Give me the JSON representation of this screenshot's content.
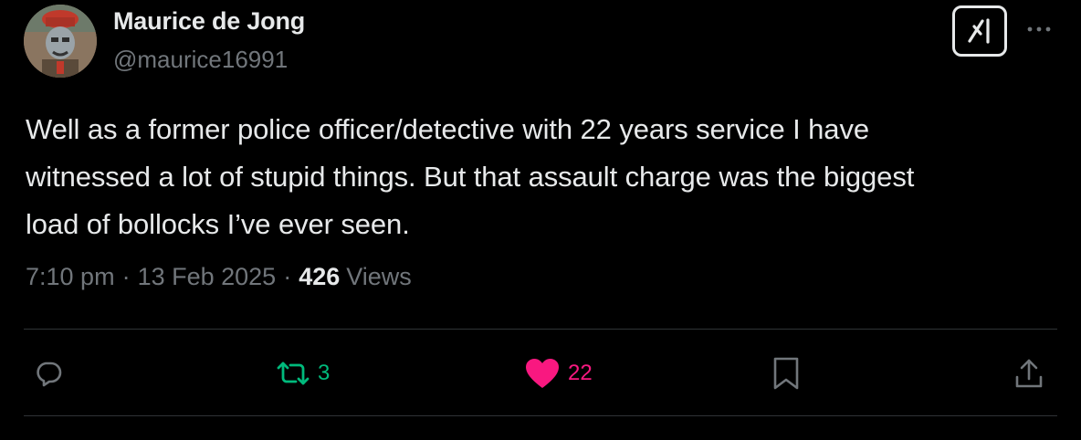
{
  "author": {
    "display_name": "Maurice de Jong",
    "handle": "@maurice16991"
  },
  "tweet": {
    "text": "Well as a former police officer/detective with 22 years service I have\nwitnessed a lot of stupid things. But that assault charge was the biggest\nload of bollocks I’ve ever seen."
  },
  "meta": {
    "time": "7:10 pm",
    "separator": "·",
    "date": "13 Feb 2025",
    "views_count": "426",
    "views_label": "Views"
  },
  "actions": {
    "reply": {
      "icon": "reply-icon",
      "count": ""
    },
    "retweet": {
      "icon": "retweet-icon",
      "count": "3",
      "color": "#00ba7c"
    },
    "like": {
      "icon": "heart-icon",
      "count": "22",
      "color": "#f91880",
      "liked": true
    },
    "bookmark": {
      "icon": "bookmark-icon"
    },
    "share": {
      "icon": "share-icon"
    }
  },
  "header_icons": {
    "grok": "grok-icon",
    "more": "more-icon"
  },
  "colors": {
    "background": "#000000",
    "primary_text": "#e7e9ea",
    "secondary_text": "#71767b",
    "divider": "#2f3336"
  }
}
